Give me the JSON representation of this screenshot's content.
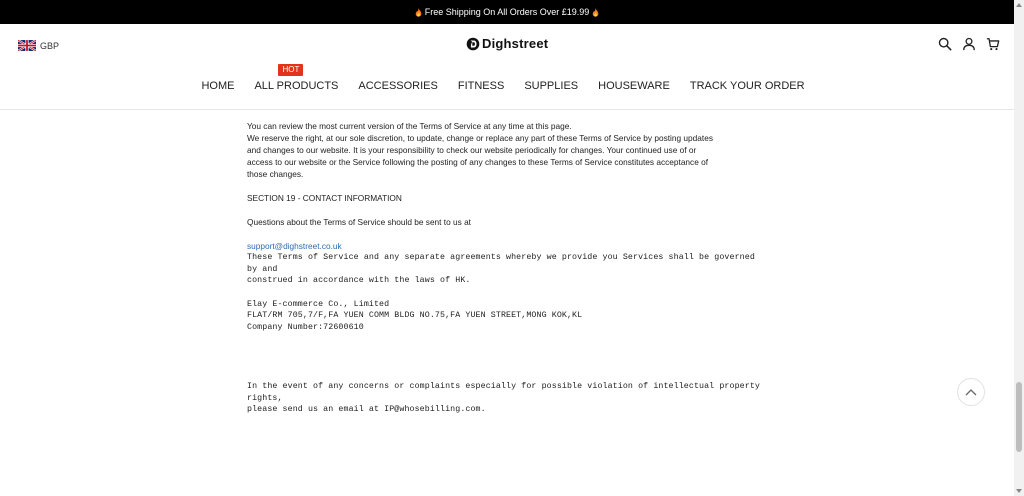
{
  "announcement": {
    "text": "Free Shipping On All Orders Over £19.99"
  },
  "header": {
    "currency": "GBP",
    "logo": "Dighstreet"
  },
  "nav": {
    "items": [
      {
        "label": "HOME"
      },
      {
        "label": "ALL PRODUCTS",
        "badge": "HOT"
      },
      {
        "label": "ACCESSORIES"
      },
      {
        "label": "FITNESS"
      },
      {
        "label": "SUPPLIES"
      },
      {
        "label": "HOUSEWARE"
      },
      {
        "label": "TRACK YOUR ORDER"
      }
    ]
  },
  "content": {
    "p1": "You can review the most current version of the Terms of Service at any time at this page.",
    "p2_l1": "We reserve the right, at our sole discretion, to update, change or replace any part of these Terms of Service by posting updates",
    "p2_l2": "and changes to our website. It is your responsibility to check our website periodically for changes. Your continued use of or",
    "p2_l3": "access to our website or the Service following the posting of any changes to these Terms of Service constitutes acceptance of",
    "p2_l4": "those changes.",
    "section_heading": "SECTION 19 - CONTACT INFORMATION",
    "questions": "Questions about the Terms of Service should be sent to us at",
    "email": "support@dighstreet.co.uk",
    "gov_l1": "These Terms of Service and any separate agreements whereby we provide you Services shall be governed by and",
    "gov_l2": "construed in accordance with the laws of HK.",
    "company_name": "Elay E-commerce Co., Limited",
    "company_address": "FLAT/RM 705,7/F,FA YUEN COMM BLDG NO.75,FA YUEN STREET,MONG KOK,KL",
    "company_number": "Company Number:72600610",
    "ip_l1": "In the event of any concerns or complaints especially for possible violation of intellectual property rights,",
    "ip_l2": "please send us an email at IP@whosebilling.com."
  },
  "colors": {
    "accent_hot": "#e4331c",
    "link": "#2a6db5"
  }
}
